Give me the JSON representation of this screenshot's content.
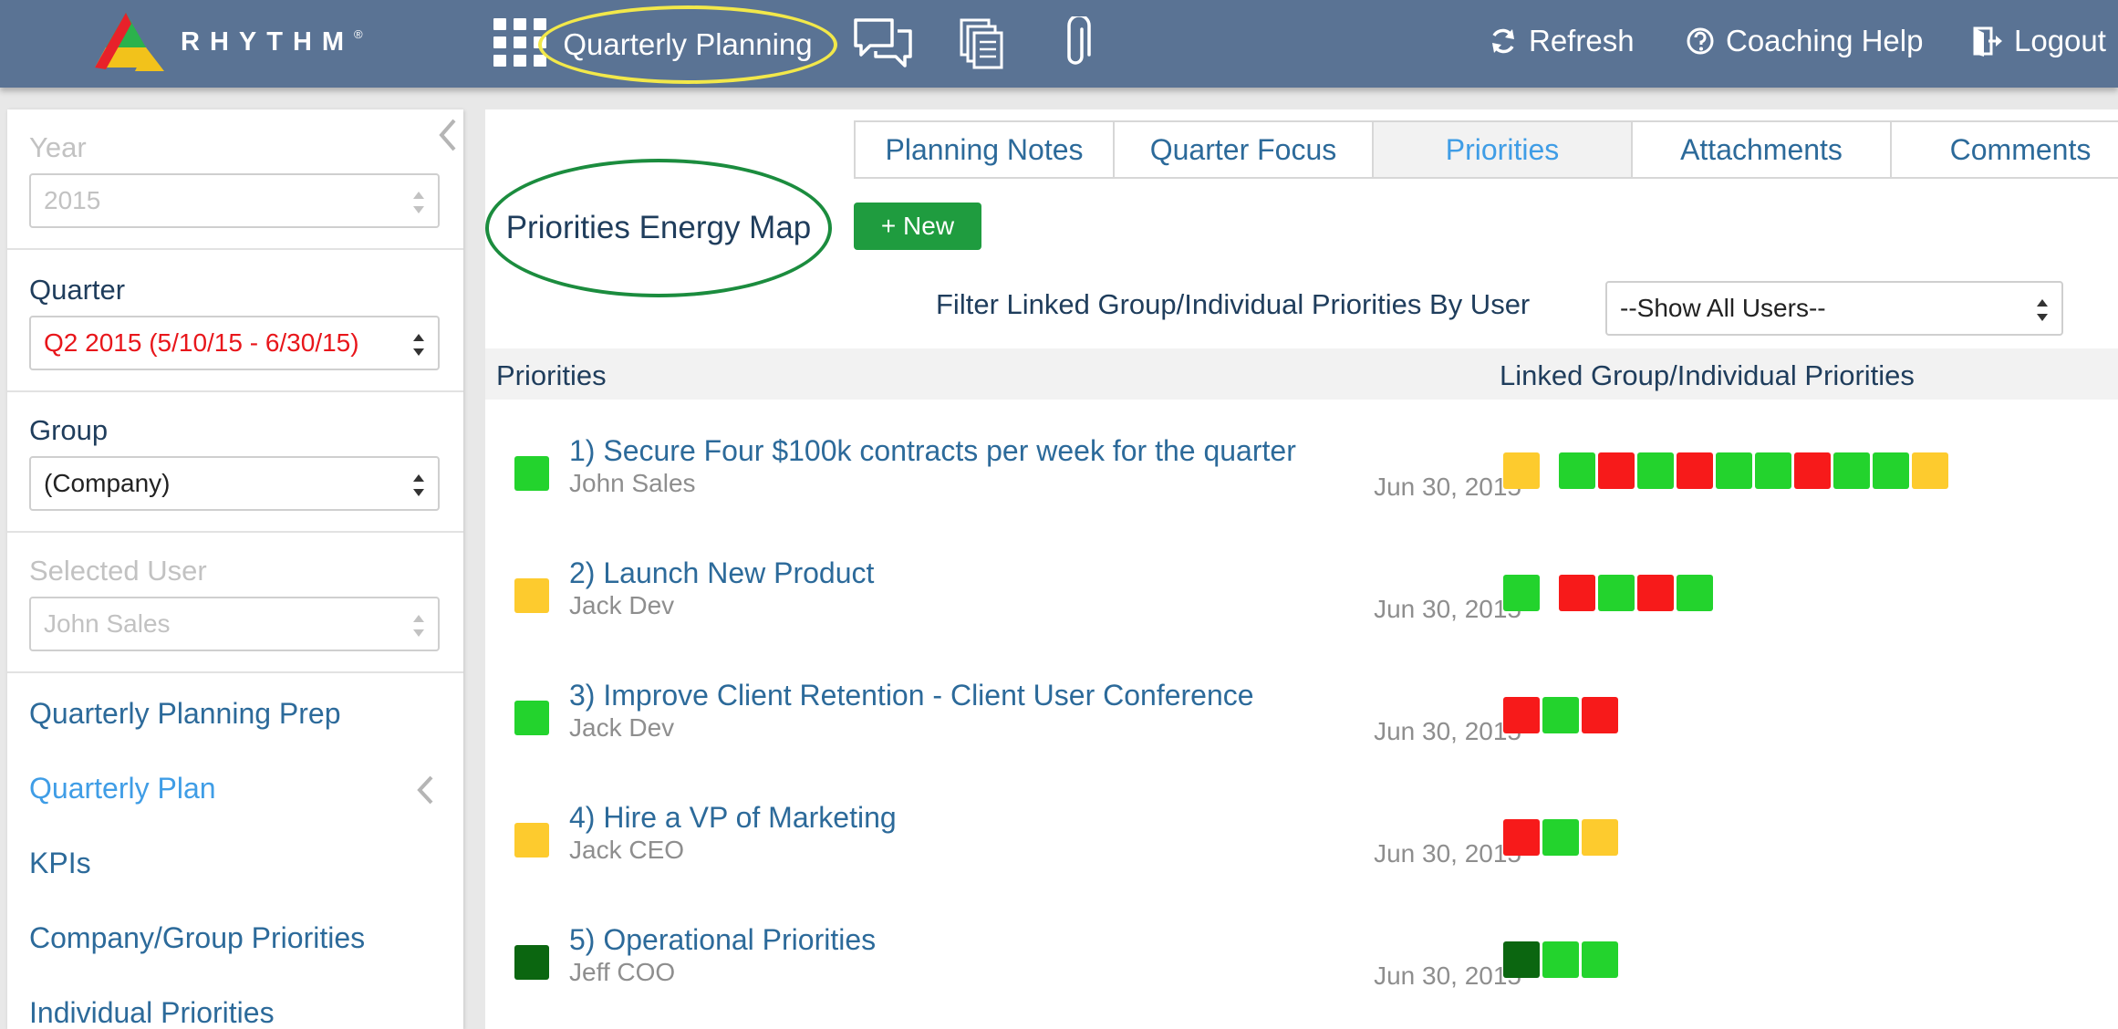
{
  "brand": {
    "name": "RHYTHM",
    "reg": "®"
  },
  "header": {
    "title": "Quarterly Planning",
    "refresh_label": "Refresh",
    "help_label": "Coaching Help",
    "logout_label": "Logout"
  },
  "sidebar": {
    "year": {
      "label": "Year",
      "value": "2015"
    },
    "quarter": {
      "label": "Quarter",
      "value": "Q2 2015 (5/10/15 - 6/30/15)"
    },
    "group": {
      "label": "Group",
      "value": "(Company)"
    },
    "selected_user": {
      "label": "Selected User",
      "value": "John Sales"
    },
    "nav": [
      {
        "label": "Quarterly Planning Prep"
      },
      {
        "label": "Quarterly Plan"
      },
      {
        "label": "KPIs"
      },
      {
        "label": "Company/Group Priorities"
      },
      {
        "label": "Individual Priorities"
      }
    ]
  },
  "tabs": [
    {
      "label": "Planning Notes"
    },
    {
      "label": "Quarter Focus"
    },
    {
      "label": "Priorities"
    },
    {
      "label": "Attachments"
    },
    {
      "label": "Comments"
    }
  ],
  "main": {
    "title": "Priorities Energy Map",
    "new_label": "+ New",
    "filter_label": "Filter Linked Group/Individual Priorities By User",
    "filter_value": "--Show All Users--",
    "col_priorities": "Priorities",
    "col_linked": "Linked Group/Individual Priorities"
  },
  "colors": {
    "green": "#23d32d",
    "red": "#f71a1a",
    "yellow": "#fdcb2e",
    "dark": "#0b6610",
    "header_bg": "#5a7394",
    "new_button": "#1f9c3f"
  },
  "priorities": [
    {
      "title": "1) Secure Four $100k contracts per week for the quarter",
      "owner": "John Sales",
      "date": "Jun 30, 2015",
      "status": "green",
      "linked_groups": [
        [
          "yellow"
        ],
        [
          "green",
          "red",
          "green",
          "red",
          "green",
          "green",
          "red",
          "green",
          "green",
          "yellow"
        ]
      ]
    },
    {
      "title": "2) Launch New Product",
      "owner": "Jack Dev",
      "date": "Jun 30, 2015",
      "status": "yellow",
      "linked_groups": [
        [
          "green"
        ],
        [
          "red",
          "green",
          "red",
          "green"
        ]
      ]
    },
    {
      "title": "3) Improve Client Retention - Client User Conference",
      "owner": "Jack Dev",
      "date": "Jun 30, 2015",
      "status": "green",
      "linked_groups": [
        [
          "red",
          "green",
          "red"
        ]
      ]
    },
    {
      "title": "4) Hire a VP of Marketing",
      "owner": "Jack CEO",
      "date": "Jun 30, 2015",
      "status": "yellow",
      "linked_groups": [
        [
          "red",
          "green",
          "yellow"
        ]
      ]
    },
    {
      "title": "5) Operational Priorities",
      "owner": "Jeff COO",
      "date": "Jun 30, 2015",
      "status": "dark",
      "linked_groups": [
        [
          "dark",
          "green",
          "green"
        ]
      ]
    }
  ]
}
